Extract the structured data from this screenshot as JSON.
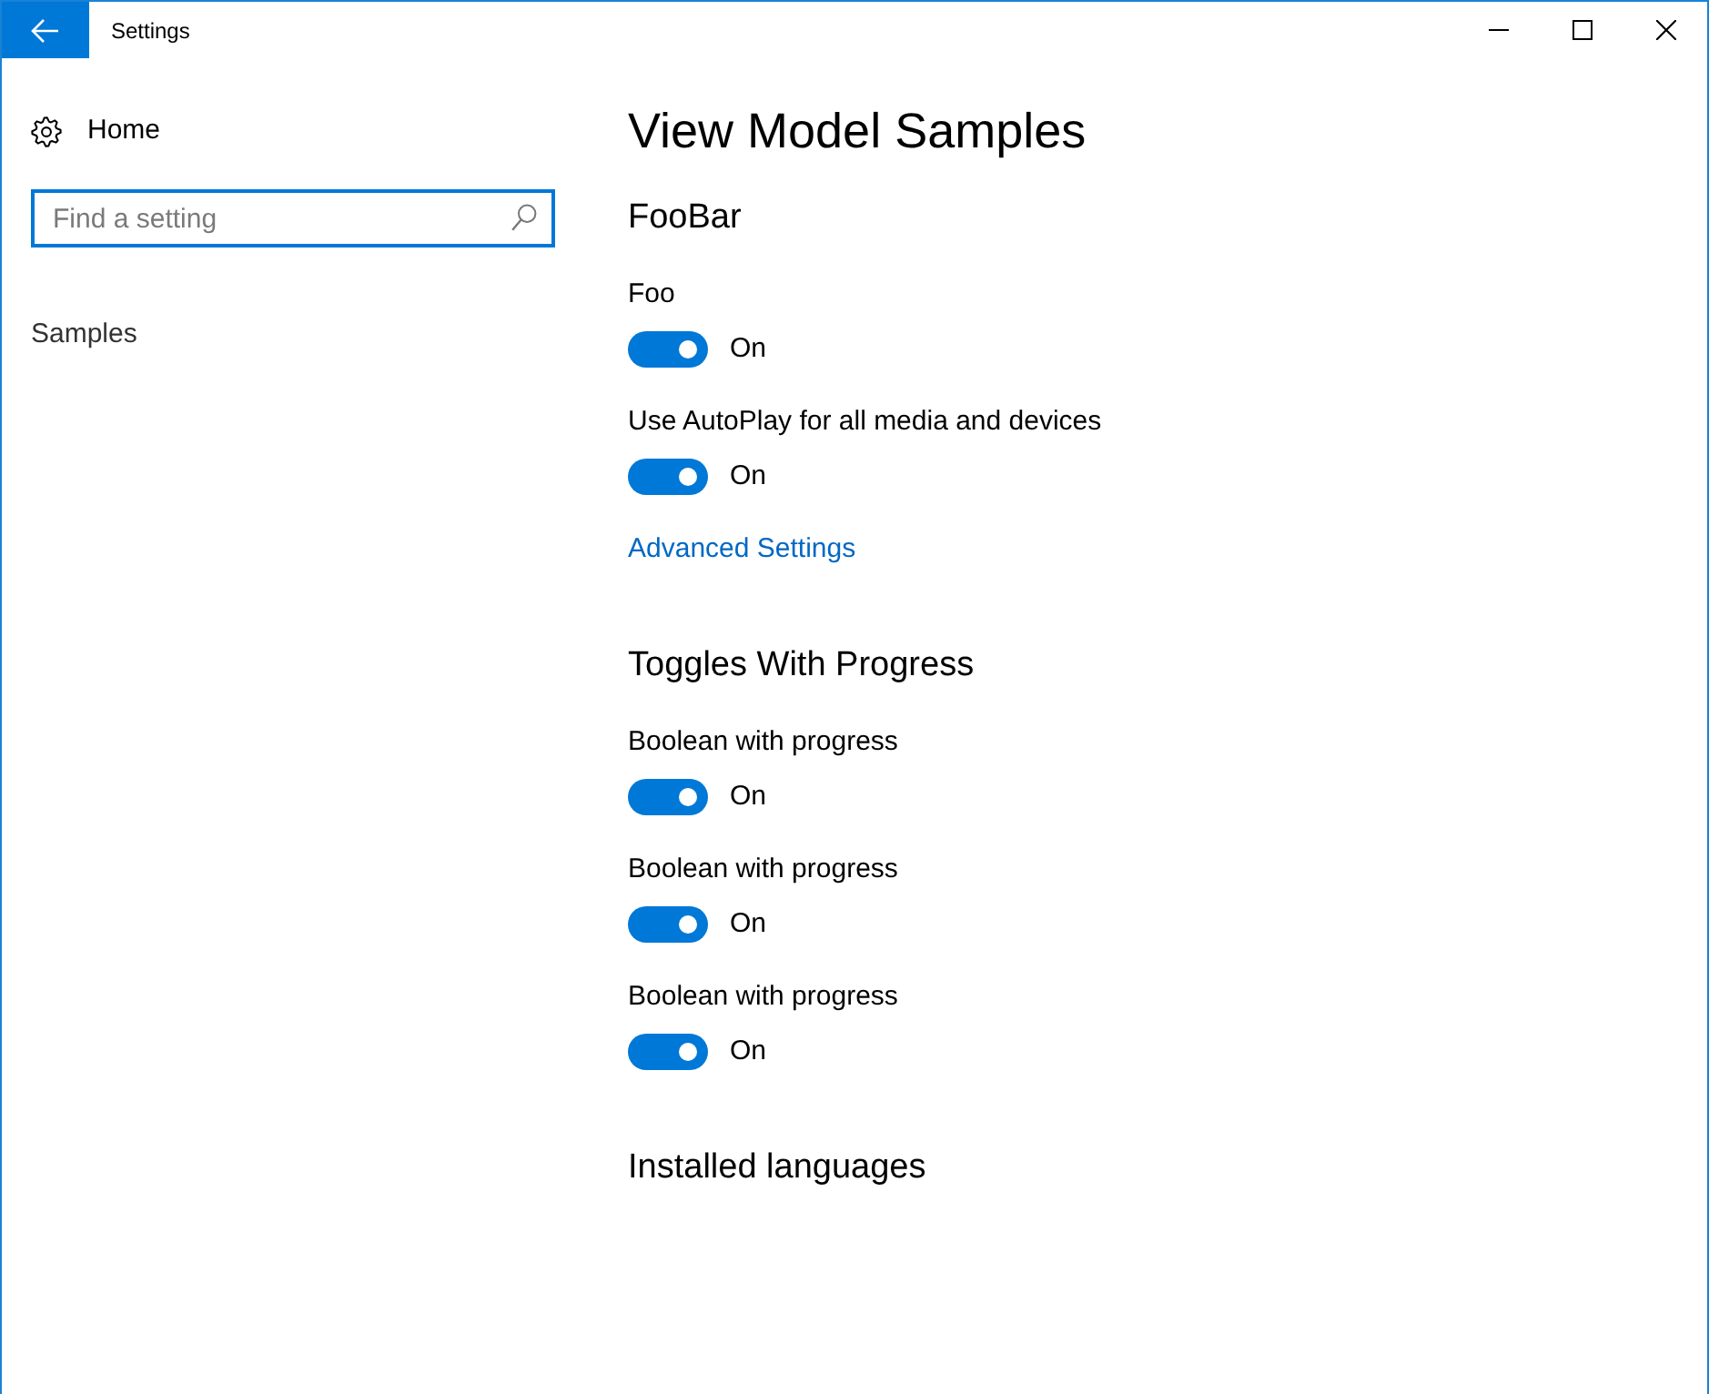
{
  "window": {
    "title": "Settings"
  },
  "sidebar": {
    "home": {
      "label": "Home"
    },
    "search": {
      "placeholder": "Find a setting"
    },
    "items": [
      {
        "label": "Samples",
        "selected": false
      }
    ]
  },
  "page": {
    "title": "View Model Samples",
    "sections": [
      {
        "title": "FooBar",
        "items": [
          {
            "kind": "toggle",
            "label": "Foo",
            "on": true,
            "state_text": "On"
          },
          {
            "kind": "toggle",
            "label": "Use AutoPlay for all media and devices",
            "on": true,
            "state_text": "On"
          },
          {
            "kind": "link",
            "label": "Advanced Settings"
          }
        ]
      },
      {
        "title": "Toggles With Progress",
        "items": [
          {
            "kind": "toggle",
            "label": "Boolean with progress",
            "on": true,
            "state_text": "On"
          },
          {
            "kind": "toggle",
            "label": "Boolean with progress",
            "on": true,
            "state_text": "On"
          },
          {
            "kind": "toggle",
            "label": "Boolean with progress",
            "on": true,
            "state_text": "On"
          }
        ]
      },
      {
        "title": "Installed languages"
      }
    ]
  }
}
